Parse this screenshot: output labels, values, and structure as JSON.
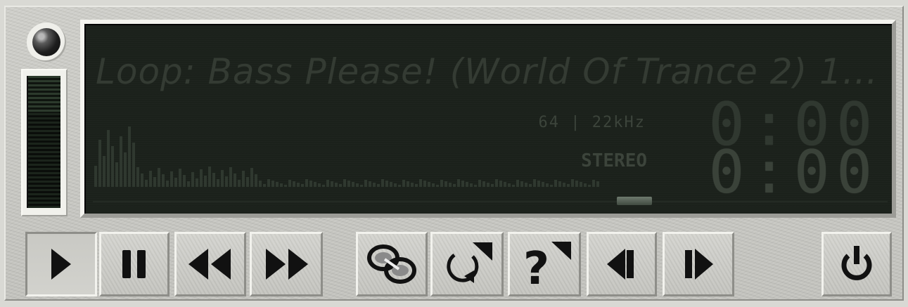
{
  "display": {
    "track_title": "Loop: Bass Please! (World Of Trance 2) 1...",
    "bitrate": "64 | 22kHz",
    "mode": "STEREO",
    "time_top": "0:00",
    "time_bottom": "0:00",
    "volume_level_percent": 72,
    "seek_position_percent": 69
  },
  "colors": {
    "lcd_background": "#1b211b",
    "lcd_text": "#343b33",
    "panel": "#c9c9c4",
    "icon": "#111111"
  },
  "controls": [
    {
      "name": "play-button",
      "icon": "play-icon"
    },
    {
      "name": "pause-button",
      "icon": "pause-icon"
    },
    {
      "name": "rewind-button",
      "icon": "rewind-icon"
    },
    {
      "name": "fast-forward-button",
      "icon": "fast-forward-icon"
    },
    {
      "name": "link-button",
      "icon": "chain-link-icon"
    },
    {
      "name": "repeat-button",
      "icon": "repeat-icon"
    },
    {
      "name": "help-button",
      "icon": "question-mark-icon"
    },
    {
      "name": "previous-track-button",
      "icon": "skip-back-icon"
    },
    {
      "name": "next-track-button",
      "icon": "skip-forward-icon"
    },
    {
      "name": "power-button",
      "icon": "power-icon"
    }
  ]
}
